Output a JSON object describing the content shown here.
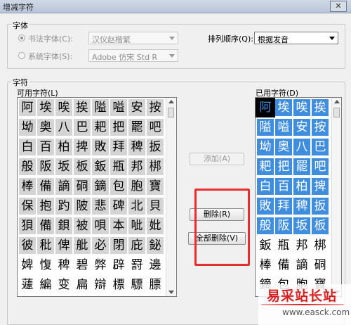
{
  "window": {
    "title": "增减字符",
    "close_glyph": "✕"
  },
  "font_group": {
    "legend": "字体",
    "calligraphy_option": "书法字体(C):",
    "calligraphy_value": "汉仪赵楷繁",
    "system_option": "系统字体(S):",
    "system_value": "Adobe 仿宋 Std R",
    "sort_label": "排列顺序(Q):",
    "sort_value": "根据发音"
  },
  "chars_group": {
    "legend": "字符",
    "available_label": "可用字符(L)",
    "used_label": "已用字符(D)"
  },
  "available_chars": [
    [
      "阿",
      "埃",
      "唉",
      "挨",
      "隘",
      "嗌",
      "安",
      "按"
    ],
    [
      "坳",
      "奥",
      "八",
      "巴",
      "耙",
      "把",
      "罷",
      "吧"
    ],
    [
      "白",
      "百",
      "柏",
      "捭",
      "敗",
      "拜",
      "稗",
      "扳"
    ],
    [
      "般",
      "阪",
      "坂",
      "板",
      "鈑",
      "瓶",
      "邦",
      "梆"
    ],
    [
      "棒",
      "備",
      "謫",
      "硐",
      "鏑",
      "包",
      "胞",
      "寶"
    ],
    [
      "保",
      "抱",
      "趵",
      "陂",
      "悲",
      "碑",
      "北",
      "貝"
    ],
    [
      "狽",
      "備",
      "鋇",
      "被",
      "唄",
      "本",
      "呲",
      "妣"
    ],
    [
      "彼",
      "秕",
      "俾",
      "舭",
      "必",
      "閉",
      "庇",
      "鉍"
    ],
    [
      "婢",
      "愎",
      "稗",
      "碧",
      "弊",
      "辟",
      "罸",
      "邊"
    ],
    [
      "蘧",
      "編",
      "变",
      "扁",
      "辯",
      "標",
      "驃",
      "膘"
    ]
  ],
  "available_shade": [
    [
      "g",
      "g",
      "g",
      "g",
      "g",
      "g",
      "g",
      "g"
    ],
    [
      "g",
      "g",
      "g",
      "g",
      "g",
      "g",
      "g",
      "g"
    ],
    [
      "g",
      "g",
      "g",
      "g",
      "g",
      "g",
      "g",
      "g"
    ],
    [
      "g",
      "g",
      "g",
      "g",
      "g",
      "g",
      "g",
      "g"
    ],
    [
      "g",
      "g",
      "g",
      "g",
      "g",
      "g",
      "g",
      "g"
    ],
    [
      "g",
      "g",
      "g",
      "g",
      "g",
      "g",
      "g",
      "g"
    ],
    [
      "g",
      "g",
      "g",
      "g",
      "g",
      "g",
      "g",
      "g"
    ],
    [
      "g",
      "g",
      "g",
      "g",
      "g",
      "g",
      "g",
      "g"
    ],
    [
      "w",
      "w",
      "w",
      "w",
      "w",
      "w",
      "w",
      "w"
    ],
    [
      "w",
      "w",
      "w",
      "w",
      "w",
      "w",
      "w",
      "w"
    ]
  ],
  "used_chars": [
    [
      "阿",
      "埃",
      "唉",
      "挨"
    ],
    [
      "隘",
      "嗌",
      "安",
      "按"
    ],
    [
      "坳",
      "奥",
      "八",
      "巴"
    ],
    [
      "耙",
      "把",
      "罷",
      "吧"
    ],
    [
      "白",
      "百",
      "柏",
      "捭"
    ],
    [
      "敗",
      "拜",
      "稗",
      "扳"
    ],
    [
      "般",
      "阪",
      "坂",
      "板"
    ],
    [
      "鈑",
      "瓶",
      "邦",
      "梆"
    ],
    [
      "棒",
      "備",
      "謫",
      "硐"
    ],
    [
      "鏑",
      "包",
      "胞",
      "寶"
    ]
  ],
  "used_shade": [
    [
      "s",
      "b",
      "b",
      "b"
    ],
    [
      "b",
      "b",
      "b",
      "b"
    ],
    [
      "b",
      "b",
      "b",
      "b"
    ],
    [
      "b",
      "b",
      "b",
      "b"
    ],
    [
      "b",
      "b",
      "b",
      "b"
    ],
    [
      "b",
      "b",
      "b",
      "b"
    ],
    [
      "b",
      "b",
      "b",
      "b"
    ],
    [
      "w",
      "w",
      "w",
      "w"
    ],
    [
      "w",
      "w",
      "w",
      "w"
    ],
    [
      "w",
      "w",
      "w",
      "w"
    ]
  ],
  "buttons": {
    "add": "添加(A)",
    "delete": "删除(R)",
    "delete_all": "全部删除(V)"
  },
  "watermark": {
    "line1": "易采站长站",
    "line2": "www.easck.com"
  },
  "colors": {
    "used_highlight": "#3e8ddf",
    "annotation_red": "#e62e2e",
    "watermark_red": "#d81e1e"
  }
}
